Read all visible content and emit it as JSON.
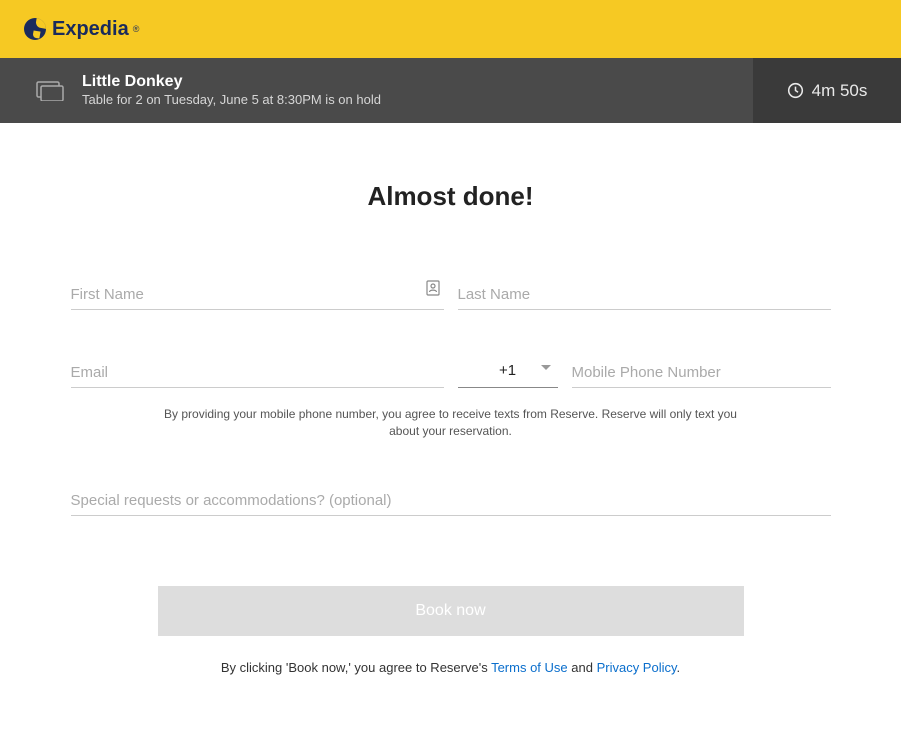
{
  "brand": {
    "name": "Expedia"
  },
  "reservation": {
    "restaurant": "Little Donkey",
    "hold_text": "Table for 2 on Tuesday, June 5 at 8:30PM is on hold"
  },
  "timer": {
    "value": "4m 50s"
  },
  "page": {
    "title": "Almost done!"
  },
  "form": {
    "first_name_placeholder": "First Name",
    "last_name_placeholder": "Last Name",
    "email_placeholder": "Email",
    "country_code": "+1",
    "phone_placeholder": "Mobile Phone Number",
    "phone_disclaimer": "By providing your mobile phone number, you agree to receive texts from Reserve. Reserve will only text you about your reservation.",
    "special_placeholder": "Special requests or accommodations? (optional)"
  },
  "cta": {
    "book_label": "Book now",
    "agree_prefix": "By clicking 'Book now,' you agree to Reserve's ",
    "terms_label": "Terms of Use",
    "and": " and ",
    "privacy_label": "Privacy Policy",
    "period": "."
  }
}
